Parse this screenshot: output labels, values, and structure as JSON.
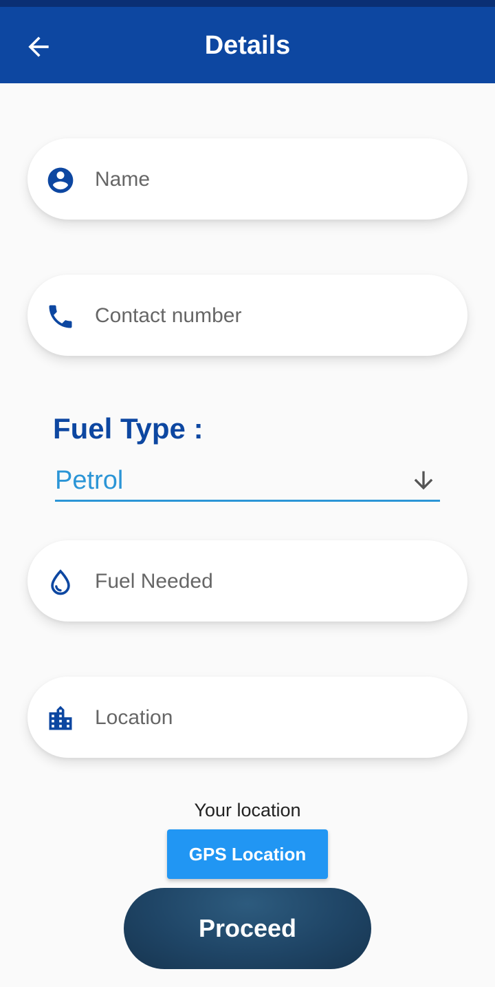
{
  "appbar": {
    "title": "Details",
    "back_icon": "arrow-left-icon"
  },
  "form": {
    "name": {
      "placeholder": "Name",
      "value": "",
      "icon": "account-circle-icon"
    },
    "contact": {
      "placeholder": "Contact number",
      "value": "",
      "icon": "phone-icon"
    },
    "fuel_type": {
      "label": "Fuel Type :",
      "selected": "Petrol",
      "icon": "arrow-down-icon"
    },
    "fuel_needed": {
      "placeholder": "Fuel Needed",
      "value": "",
      "icon": "water-drop-icon"
    },
    "location": {
      "placeholder": "Location",
      "value": "",
      "icon": "location-city-icon"
    }
  },
  "location_section": {
    "label": "Your location",
    "gps_button": "GPS Location"
  },
  "proceed_button": "Proceed",
  "colors": {
    "primary": "#0d47a1",
    "accent": "#2196f3",
    "select_underline": "#2b95d6",
    "proceed": "#1f4566",
    "background": "#fafafa"
  }
}
